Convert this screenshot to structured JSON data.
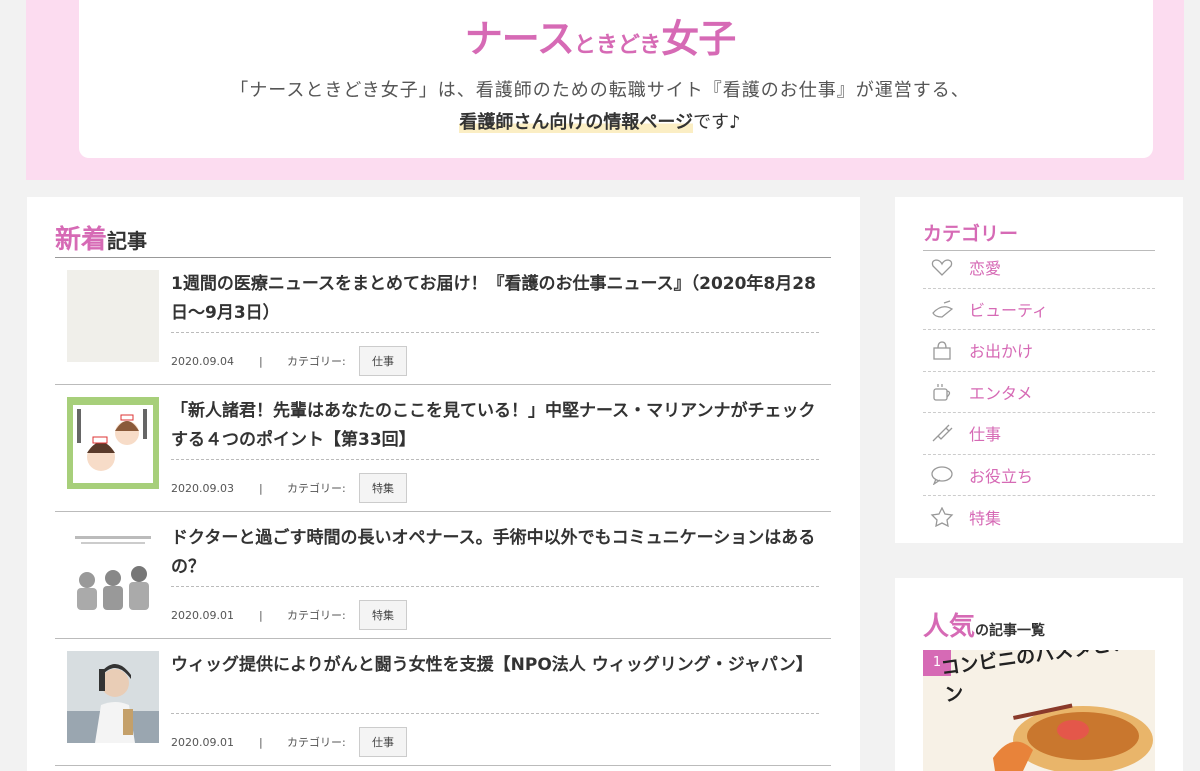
{
  "header": {
    "logo_main": "ナース",
    "logo_small": "ときどき",
    "logo_end": "女子",
    "intro_line1": "「ナースときどき女子」は、看護師のための転職サイト『看護のお仕事』が運営する、",
    "intro_highlight": "看護師さん向けの情報ページ",
    "intro_end": "です♪"
  },
  "main": {
    "title_accent": "新着",
    "title_rest": "記事",
    "articles": [
      {
        "title": "1週間の医療ニュースをまとめてお届け！『看護のお仕事ニュース』（2020年8月28日～9月3日）",
        "date": "2020.09.04",
        "sep": "|",
        "category_label": "カテゴリー:",
        "category": "仕事"
      },
      {
        "title": "「新人諸君！先輩はあなたのここを見ている！」中堅ナース・マリアンナがチェックする４つのポイント【第33回】",
        "date": "2020.09.03",
        "sep": "|",
        "category_label": "カテゴリー:",
        "category": "特集"
      },
      {
        "title": "ドクターと過ごす時間の長いオペナース。手術中以外でもコミュニケーションはあるの？",
        "date": "2020.09.01",
        "sep": "|",
        "category_label": "カテゴリー:",
        "category": "特集"
      },
      {
        "title": "ウィッグ提供によりがんと闘う女性を支援【NPO法人 ウィッグリング・ジャパン】",
        "date": "2020.09.01",
        "sep": "|",
        "category_label": "カテゴリー:",
        "category": "仕事"
      }
    ]
  },
  "sidebar": {
    "category_title": "カテゴリー",
    "categories": [
      {
        "label": "恋愛",
        "icon": "heart-icon"
      },
      {
        "label": "ビューティ",
        "icon": "cosmetics-icon"
      },
      {
        "label": "お出かけ",
        "icon": "bag-icon"
      },
      {
        "label": "エンタメ",
        "icon": "cup-icon"
      },
      {
        "label": "仕事",
        "icon": "syringe-icon"
      },
      {
        "label": "お役立ち",
        "icon": "speech-bubble-icon"
      },
      {
        "label": "特集",
        "icon": "star-icon"
      }
    ],
    "popular_accent": "人気",
    "popular_rest": "の記事一覧",
    "popular_rank": "1",
    "popular_caption": "コンビニのパスタとチキン"
  },
  "colors": {
    "accent": "#d66ab5",
    "header_band": "#fcdcf0",
    "highlight": "#fbeec4"
  }
}
